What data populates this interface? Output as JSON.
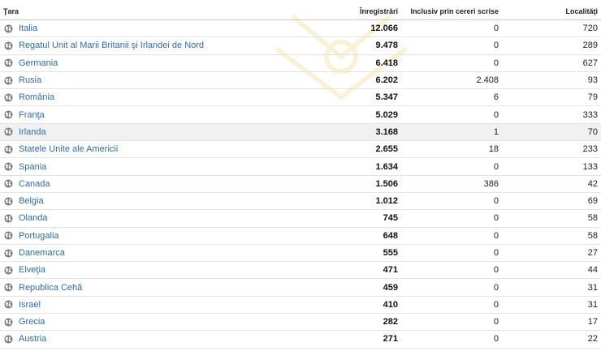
{
  "table": {
    "headers": {
      "country": "Ţara",
      "registrations": "Înregistrări",
      "written_requests": "Inclusiv prin cereri scrise",
      "localities": "Localităţi"
    },
    "rows": [
      {
        "country": "Italia",
        "registrations": "12.066",
        "written_requests": "0",
        "localities": "720",
        "icon": "globe-icon"
      },
      {
        "country": "Regatul Unit al Marii Britanii şi Irlandei de Nord",
        "registrations": "9.478",
        "written_requests": "0",
        "localities": "289",
        "icon": "globe-icon"
      },
      {
        "country": "Germania",
        "registrations": "6.418",
        "written_requests": "0",
        "localities": "627",
        "icon": "globe-icon"
      },
      {
        "country": "Rusia",
        "registrations": "6.202",
        "written_requests": "2.408",
        "localities": "93",
        "icon": "globe-icon"
      },
      {
        "country": "România",
        "registrations": "5.347",
        "written_requests": "6",
        "localities": "79",
        "icon": "globe-icon"
      },
      {
        "country": "Franţa",
        "registrations": "5.029",
        "written_requests": "0",
        "localities": "333",
        "icon": "globe-icon"
      },
      {
        "country": "Irlanda",
        "registrations": "3.168",
        "written_requests": "1",
        "localities": "70",
        "icon": "globe-icon",
        "highlighted": true
      },
      {
        "country": "Statele Unite ale Americii",
        "registrations": "2.655",
        "written_requests": "18",
        "localities": "233",
        "icon": "globe-icon"
      },
      {
        "country": "Spania",
        "registrations": "1.634",
        "written_requests": "0",
        "localities": "133",
        "icon": "globe-icon"
      },
      {
        "country": "Canada",
        "registrations": "1.506",
        "written_requests": "386",
        "localities": "42",
        "icon": "globe-icon"
      },
      {
        "country": "Belgia",
        "registrations": "1.012",
        "written_requests": "0",
        "localities": "69",
        "icon": "globe-icon"
      },
      {
        "country": "Olanda",
        "registrations": "745",
        "written_requests": "0",
        "localities": "58",
        "icon": "globe-icon"
      },
      {
        "country": "Portugalia",
        "registrations": "648",
        "written_requests": "0",
        "localities": "58",
        "icon": "globe-icon"
      },
      {
        "country": "Danemarca",
        "registrations": "555",
        "written_requests": "0",
        "localities": "27",
        "icon": "globe-icon"
      },
      {
        "country": "Elveţia",
        "registrations": "471",
        "written_requests": "0",
        "localities": "44",
        "icon": "globe-icon"
      },
      {
        "country": "Republica Cehă",
        "registrations": "459",
        "written_requests": "0",
        "localities": "31",
        "icon": "globe-icon"
      },
      {
        "country": "Israel",
        "registrations": "410",
        "written_requests": "0",
        "localities": "31",
        "icon": "globe-icon"
      },
      {
        "country": "Grecia",
        "registrations": "282",
        "written_requests": "0",
        "localities": "17",
        "icon": "globe-icon"
      },
      {
        "country": "Austria",
        "registrations": "271",
        "written_requests": "0",
        "localities": "22",
        "icon": "globe-icon"
      }
    ]
  },
  "colors": {
    "link": "#2d6bb3",
    "row_highlight": "#f1f1f1",
    "border": "#e2e2e2"
  }
}
